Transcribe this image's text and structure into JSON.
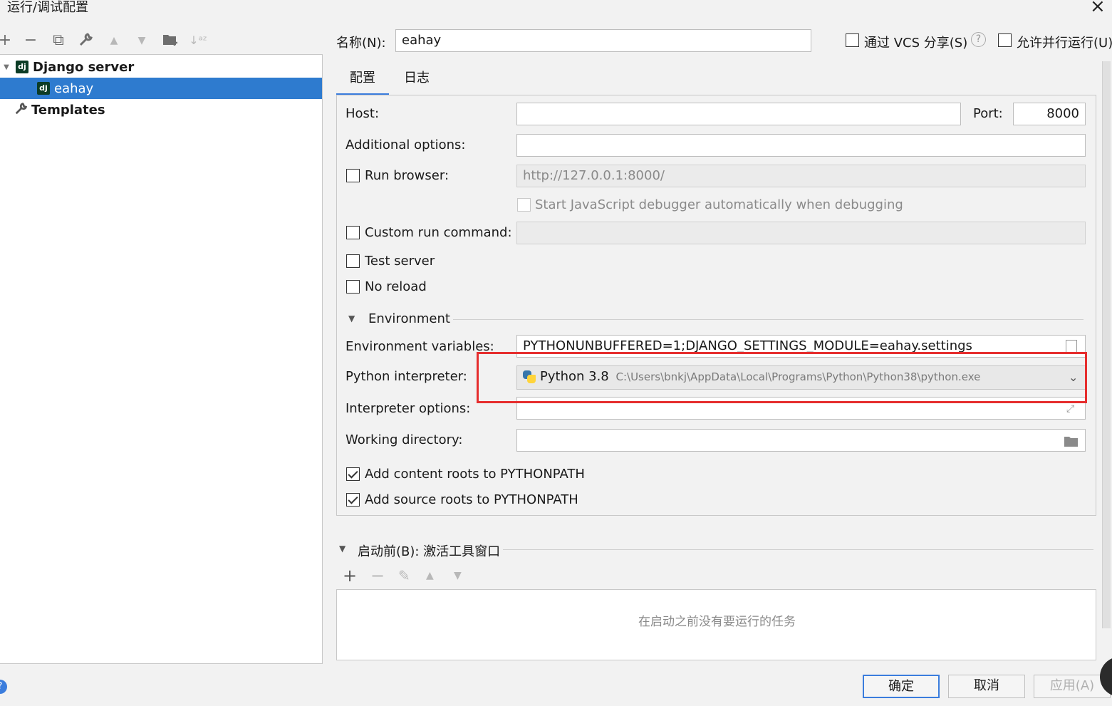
{
  "window": {
    "title": "运行/调试配置"
  },
  "toolbar": {
    "icons": [
      "add-icon",
      "remove-icon",
      "copy-icon",
      "wrench-icon",
      "up-arrow-icon",
      "down-arrow-icon",
      "new-folder-icon",
      "sort-icon"
    ],
    "add": "+",
    "remove": "−",
    "copy": "⧉",
    "wrench": "🔧",
    "up": "▲",
    "down": "▼",
    "folder": "📁",
    "sort": "↓ᵃᶻ"
  },
  "tree": {
    "items": [
      {
        "label": "Django server",
        "icon": "dj"
      },
      {
        "label": "eahay",
        "icon": "dj"
      },
      {
        "label": "Templates",
        "icon": "wrench"
      }
    ],
    "dj_glyph": "dj",
    "expand_glyph": "▼",
    "wrench_glyph": "🔧"
  },
  "header": {
    "name_label": "名称(N):",
    "name_value": "eahay",
    "vcs_label": "通过 VCS 分享(S)",
    "help_glyph": "?",
    "parallel_label": "允许并行运行(U)"
  },
  "tabs": [
    "配置",
    "日志"
  ],
  "config": {
    "host_label": "Host:",
    "host_value": "",
    "port_label": "Port:",
    "port_value": "8000",
    "additional_label": "Additional options:",
    "additional_value": "",
    "run_browser_label": "Run browser:",
    "run_browser_value": "http://127.0.0.1:8000/",
    "js_debugger_label": "Start JavaScript debugger automatically when debugging",
    "custom_cmd_label": "Custom run command:",
    "test_server_label": "Test server",
    "no_reload_label": "No reload",
    "environment_label": "Environment",
    "env_vars_label": "Environment variables:",
    "env_vars_value": "PYTHONUNBUFFERED=1;DJANGO_SETTINGS_MODULE=eahay.settings",
    "interpreter_label": "Python interpreter:",
    "interpreter_name": "Python 3.8",
    "interpreter_path": "C:\\Users\\bnkj\\AppData\\Local\\Programs\\Python\\Python38\\python.exe",
    "interp_options_label": "Interpreter options:",
    "working_dir_label": "Working directory:",
    "content_roots_label": "Add content roots to PYTHONPATH",
    "source_roots_label": "Add source roots to PYTHONPATH"
  },
  "before_launch": {
    "label": "启动前(B): 激活工具窗口",
    "empty_text": "在启动之前没有要运行的任务",
    "add": "+",
    "remove": "−",
    "edit": "✎",
    "up": "▲",
    "down": "▼"
  },
  "buttons": {
    "ok": "确定",
    "cancel": "取消",
    "apply": "应用(A)"
  },
  "colors": {
    "selection": "#2e7bcf",
    "highlight": "#e62e2e",
    "accent": "#3b7ddd"
  }
}
